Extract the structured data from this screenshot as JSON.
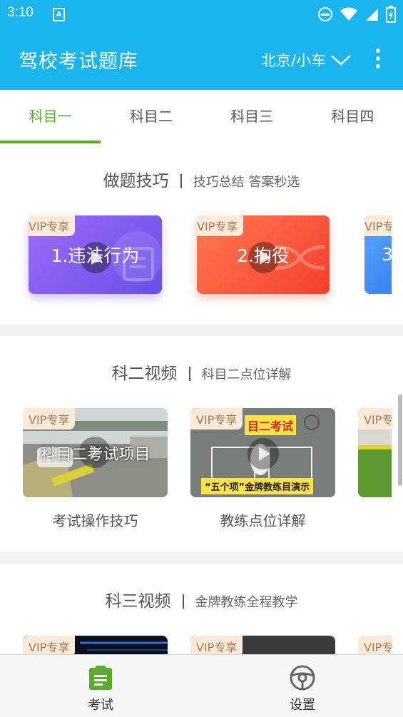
{
  "status": {
    "time": "3:10"
  },
  "appbar": {
    "title": "驾校考试题库",
    "region": "北京/小车"
  },
  "tabs": [
    "科目一",
    "科目二",
    "科目三",
    "科目四"
  ],
  "vip_badge": "VIP专享",
  "sections": {
    "tips": {
      "title": "做题技巧",
      "subtitle": "技巧总结 答案秒选",
      "cards": [
        "1.违法行为",
        "2.拘役"
      ]
    },
    "k2": {
      "title": "科二视频",
      "subtitle": "科目二点位详解",
      "overlay1": "科目二考试项目",
      "thumb2_top": "目二考试",
      "thumb2_bottom": "“五个项”金牌教练目演示",
      "captions": [
        "考试操作技巧",
        "教练点位详解"
      ]
    },
    "k3": {
      "title": "科三视频",
      "subtitle": "金牌教练全程教学"
    }
  },
  "bottom_nav": {
    "exam": "考试",
    "settings": "设置"
  },
  "colors": {
    "primary": "#1ab5ee",
    "accent": "#5aac2c"
  }
}
